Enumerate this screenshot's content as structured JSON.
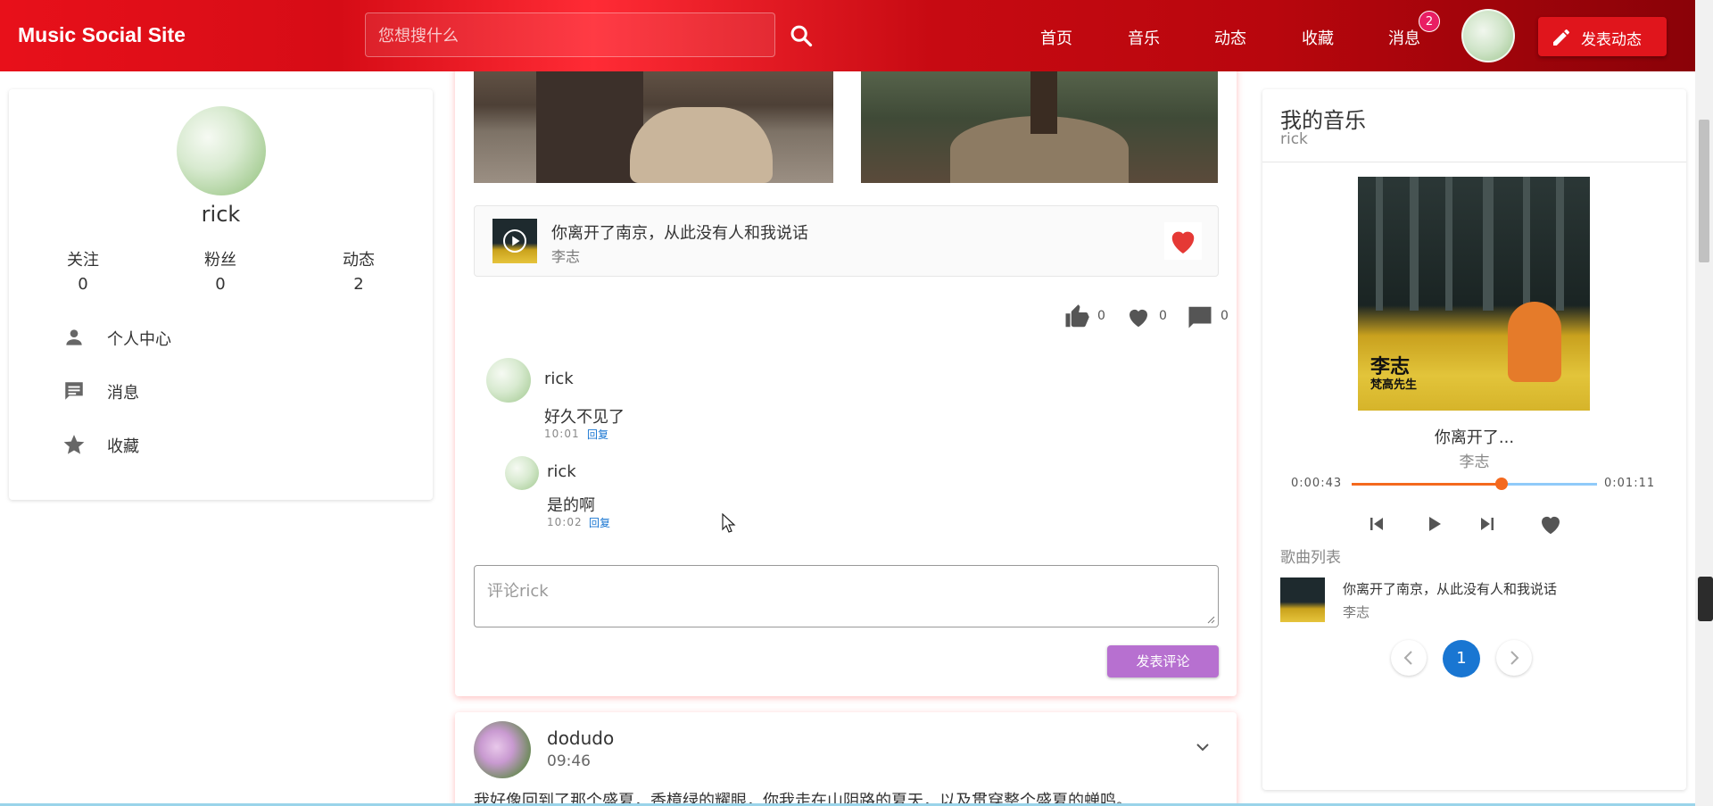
{
  "header": {
    "brand": "Music Social Site",
    "search_placeholder": "您想搜什么",
    "nav": [
      "首页",
      "音乐",
      "动态",
      "收藏",
      "消息"
    ],
    "message_badge": "2",
    "post_button": "发表动态",
    "colors": {
      "primary": "#e0151c",
      "badge": "#e91e63"
    }
  },
  "profile": {
    "name": "rick",
    "stats": [
      {
        "label": "关注",
        "value": "0"
      },
      {
        "label": "粉丝",
        "value": "0"
      },
      {
        "label": "动态",
        "value": "2"
      }
    ],
    "menu": [
      {
        "label": "个人中心",
        "icon": "person-icon"
      },
      {
        "label": "消息",
        "icon": "message-icon"
      },
      {
        "label": "收藏",
        "icon": "star-icon"
      }
    ]
  },
  "feed": {
    "song": {
      "title": "你离开了南京，从此没有人和我说话",
      "artist": "李志"
    },
    "actions": {
      "likes": "0",
      "favorites": "0",
      "comments": "0"
    },
    "comments": [
      {
        "user": "rick",
        "text": "好久不见了",
        "time": "10:01",
        "reply": "回复"
      },
      {
        "user": "rick",
        "text": "是的啊",
        "time": "10:02",
        "reply": "回复"
      }
    ],
    "comment_placeholder": "评论rick",
    "submit_label": "发表评论",
    "next_post": {
      "user": "dodudo",
      "time": "09:46",
      "text": "我好像回到了那个盛夏，香樟绿的耀眼，你我走在山阴路的夏天，以及贯穿整个盛夏的蝉鸣。"
    }
  },
  "music": {
    "title": "我的音乐",
    "subtitle": "rick",
    "cover_text_1": "李志",
    "cover_text_2": "梵高先生",
    "now_title": "你离开了...",
    "now_artist": "李志",
    "time_current": "0:00:43",
    "time_total": "0:01:11",
    "progress": 0.61,
    "list_label": "歌曲列表",
    "list": [
      {
        "title": "你离开了南京，从此没有人和我说话",
        "artist": "李志"
      }
    ],
    "page": "1",
    "colors": {
      "progress": "#f4691e",
      "track": "#90caf9",
      "page": "#1976d2"
    }
  }
}
